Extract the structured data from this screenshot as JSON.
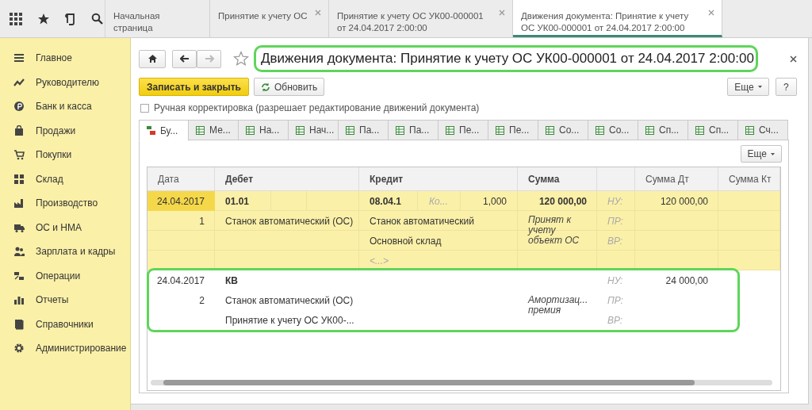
{
  "app_tabs": [
    {
      "label": "Начальная страница",
      "selected": false,
      "closable": false
    },
    {
      "label": "Принятие к учету ОС",
      "selected": false,
      "closable": true
    },
    {
      "label": "Принятие к учету ОС УК00-000001 от 24.04.2017 2:00:00",
      "selected": false,
      "closable": true
    },
    {
      "label": "Движения документа: Принятие к учету ОС УК00-000001 от 24.04.2017 2:00:00",
      "selected": true,
      "closable": true
    }
  ],
  "sidebar": {
    "items": [
      {
        "label": "Главное"
      },
      {
        "label": "Руководителю"
      },
      {
        "label": "Банк и касса"
      },
      {
        "label": "Продажи"
      },
      {
        "label": "Покупки"
      },
      {
        "label": "Склад"
      },
      {
        "label": "Производство"
      },
      {
        "label": "ОС и НМА"
      },
      {
        "label": "Зарплата и кадры"
      },
      {
        "label": "Операции"
      },
      {
        "label": "Отчеты"
      },
      {
        "label": "Справочники"
      },
      {
        "label": "Администрирование"
      }
    ]
  },
  "form": {
    "title": "Движения документа: Принятие к учету ОС УК00-000001 от 24.04.2017 2:00:00",
    "nav": {
      "back_enabled": true,
      "forward_enabled": false
    },
    "save_button": "Записать и закрыть",
    "refresh_button": "Обновить",
    "more_button": "Еще",
    "help_button": "?",
    "manual_edit": {
      "label": "Ручная корректировка (разрешает редактирование движений документа)",
      "checked": false
    }
  },
  "register_tabs": [
    {
      "label": "Бу...",
      "kind": "ledger",
      "selected": true
    },
    {
      "label": "Ме...",
      "kind": "table",
      "selected": false
    },
    {
      "label": "На...",
      "kind": "table",
      "selected": false
    },
    {
      "label": "Нач...",
      "kind": "table",
      "selected": false
    },
    {
      "label": "Па...",
      "kind": "table",
      "selected": false
    },
    {
      "label": "Па...",
      "kind": "table",
      "selected": false
    },
    {
      "label": "Пе...",
      "kind": "table",
      "selected": false
    },
    {
      "label": "Пе...",
      "kind": "table",
      "selected": false
    },
    {
      "label": "Со...",
      "kind": "table",
      "selected": false
    },
    {
      "label": "Со...",
      "kind": "table",
      "selected": false
    },
    {
      "label": "Сп...",
      "kind": "table",
      "selected": false
    },
    {
      "label": "Сп...",
      "kind": "table",
      "selected": false
    },
    {
      "label": "Сч...",
      "kind": "table",
      "selected": false
    }
  ],
  "table": {
    "more_button": "Еще",
    "columns": [
      {
        "kind": "text",
        "label": "Дата"
      },
      {
        "kind": "text",
        "label": "Дебет"
      },
      {
        "kind": "text",
        "label": "Кредит"
      },
      {
        "kind": "text",
        "label": "Сумма"
      },
      {
        "kind": "blank"
      },
      {
        "kind": "text",
        "label": "Сумма Дт"
      },
      {
        "kind": "text",
        "label": "Сумма Кт"
      }
    ],
    "rows": [
      {
        "selected": true,
        "date": "24.04.2017",
        "number": "1",
        "debit_account": "01.01",
        "debit_lines": [
          "Станок автоматический (ОС)"
        ],
        "credit_account": "08.04.1",
        "credit_subconto": "Ко...",
        "quantity": "1,000",
        "credit_lines": [
          "Станок автоматический",
          "Основной склад"
        ],
        "credit_empty": "<...>",
        "amount": "120 000,00",
        "note_lines": [
          "Принят к учету объект ОС"
        ],
        "labels": [
          "НУ:",
          "ПР:",
          "ВР:"
        ],
        "amount_dt": "120 000,00"
      },
      {
        "selected": false,
        "date": "24.04.2017",
        "number": "2",
        "debit_account": "КВ",
        "debit_lines": [
          "Станок автоматический (ОС)",
          "Принятие к учету ОС УК00-..."
        ],
        "note_lines": [
          "Амортизац...",
          "премия"
        ],
        "labels": [
          "НУ:",
          "ПР:",
          "ВР:"
        ],
        "amount_dt": "24 000,00"
      }
    ]
  }
}
